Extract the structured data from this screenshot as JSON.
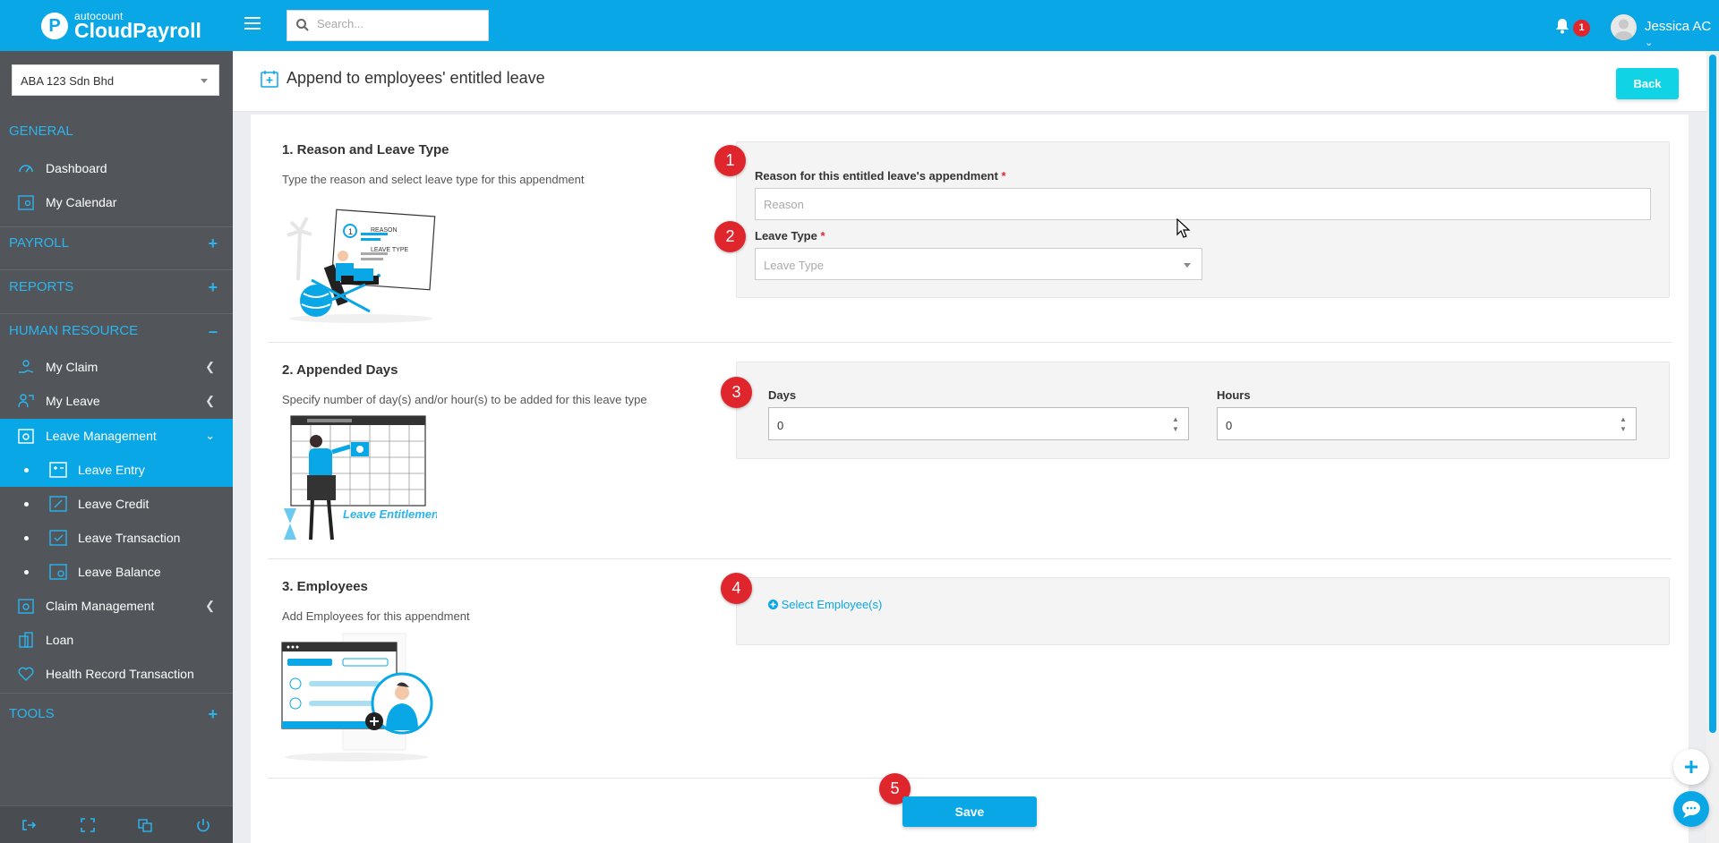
{
  "header": {
    "brand_small": "autocount",
    "brand_big": "CloudPayroll",
    "search_placeholder": "Search...",
    "notification_count": "1",
    "user_name": "Jessica AC"
  },
  "sidebar": {
    "company": "ABA 123 Sdn Bhd",
    "sections": {
      "general": "GENERAL",
      "payroll": "PAYROLL",
      "reports": "REPORTS",
      "human_resource": "HUMAN RESOURCE",
      "tools": "TOOLS"
    },
    "items": {
      "dashboard": "Dashboard",
      "my_calendar": "My Calendar",
      "my_claim": "My Claim",
      "my_leave": "My Leave",
      "leave_management": "Leave Management",
      "leave_entry": "Leave Entry",
      "leave_credit": "Leave Credit",
      "leave_transaction": "Leave Transaction",
      "leave_balance": "Leave Balance",
      "claim_management": "Claim Management",
      "loan": "Loan",
      "health_record": "Health Record Transaction"
    }
  },
  "page": {
    "title": "Append to employees' entitled leave",
    "back_label": "Back",
    "save_label": "Save"
  },
  "sections": {
    "reason": {
      "title": "1. Reason and Leave Type",
      "description": "Type the reason and select leave type for this appendment",
      "illus_reason": "REASON",
      "illus_leave_type": "LEAVE TYPE",
      "reason_label": "Reason for this entitled leave's appendment",
      "reason_placeholder": "Reason",
      "leave_type_label": "Leave Type",
      "leave_type_placeholder": "Leave Type"
    },
    "days": {
      "title": "2. Appended Days",
      "description": "Specify number of day(s) and/or hour(s) to be added for this leave type",
      "illus_caption": "Leave Entitlement",
      "days_label": "Days",
      "days_value": "0",
      "hours_label": "Hours",
      "hours_value": "0"
    },
    "employees": {
      "title": "3. Employees",
      "description": "Add Employees for this appendment",
      "select_label": "Select Employee(s)"
    }
  },
  "markers": [
    "1",
    "2",
    "3",
    "4",
    "5"
  ],
  "required_mark": "*",
  "colors": {
    "accent": "#0aa7e6",
    "sidebar": "#52565a",
    "back_button": "#10d3e6",
    "badge": "#e0262d"
  }
}
